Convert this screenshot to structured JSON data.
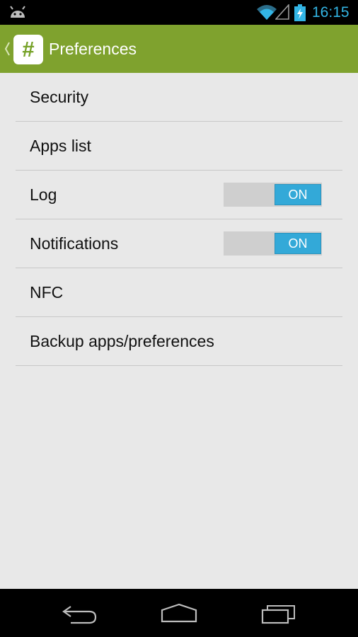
{
  "status_bar": {
    "time": "16:15",
    "notification_icon": "android-icon",
    "wifi_icon": "wifi-icon",
    "signal_icon": "signal-icon",
    "battery_icon": "battery-charging-icon",
    "clock_color": "#33b5e5"
  },
  "action_bar": {
    "title": "Preferences",
    "app_icon_glyph": "#",
    "background_color": "#7fa22e",
    "up_icon": "chevron-left-icon"
  },
  "preferences": {
    "items": [
      {
        "label": "Security"
      },
      {
        "label": "Apps list"
      },
      {
        "label": "Log",
        "toggle": "ON"
      },
      {
        "label": "Notifications",
        "toggle": "ON"
      },
      {
        "label": "NFC"
      },
      {
        "label": "Backup apps/preferences"
      }
    ],
    "toggle_color": "#33a9d8"
  },
  "nav_bar": {
    "back_icon": "back-icon",
    "home_icon": "home-icon",
    "recents_icon": "recent-apps-icon"
  }
}
